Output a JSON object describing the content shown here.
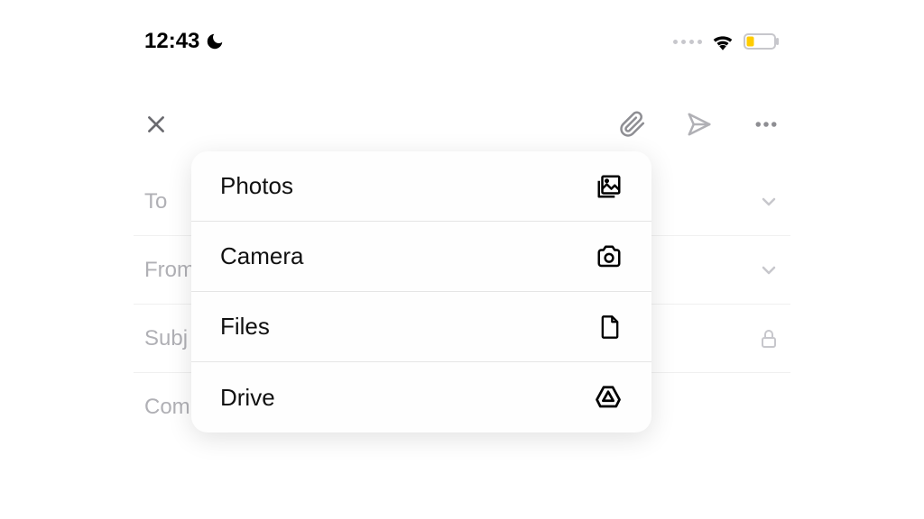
{
  "statusBar": {
    "time": "12:43"
  },
  "compose": {
    "toLabel": "To",
    "fromLabel": "From",
    "subjectLabel": "Subj",
    "bodyLabel": "Com"
  },
  "attachMenu": {
    "items": [
      {
        "label": "Photos"
      },
      {
        "label": "Camera"
      },
      {
        "label": "Files"
      },
      {
        "label": "Drive"
      }
    ]
  }
}
